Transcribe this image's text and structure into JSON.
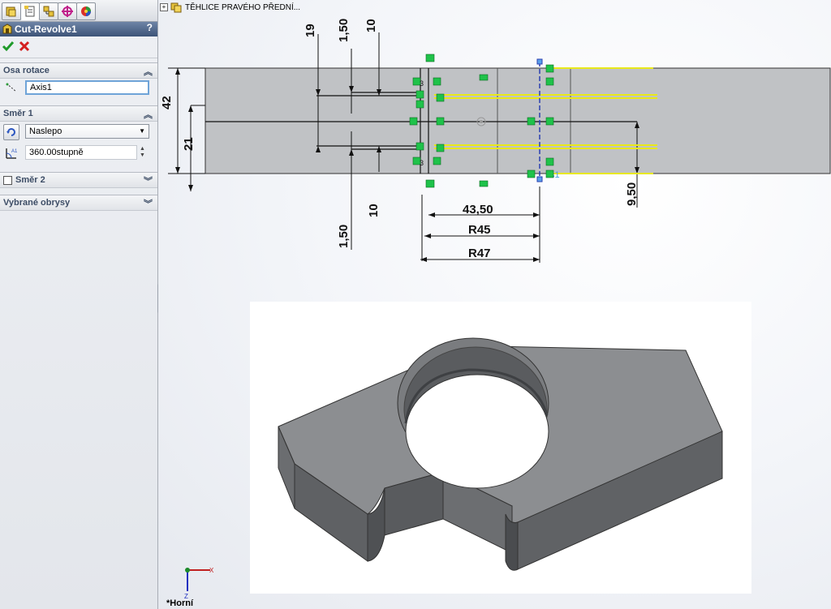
{
  "property_manager": {
    "tab_icons": [
      "feature-manager-icon",
      "property-manager-icon",
      "configuration-manager-icon",
      "dimxpert-icon",
      "appearance-icon"
    ],
    "feature_title": "Cut-Revolve1",
    "help_label": "?",
    "ok_icon": "checkmark-icon",
    "cancel_icon": "x-icon",
    "axis_section": {
      "label": "Osa rotace",
      "axis_value": "Axis1"
    },
    "direction1_section": {
      "label": "Směr 1",
      "type_value": "Naslepo",
      "angle_value": "360.00stupně"
    },
    "direction2_section": {
      "label": "Směr 2",
      "checked": false
    },
    "contours_section": {
      "label": "Vybrané obrysy"
    }
  },
  "viewport": {
    "tree_item": "TĚHLICE PRAVÉHO PŘEDNÍ...",
    "view_label": "*Horní",
    "triad_x": "X",
    "triad_z": "Z",
    "dimensions": {
      "d19": "19",
      "d150_top": "1,50",
      "d10_top": "10",
      "d42": "42",
      "d21": "21",
      "d10_bottom": "10",
      "d150_bottom": "1,50",
      "d4350": "43,50",
      "r45": "R45",
      "r47": "R47",
      "d950": "9,50"
    },
    "axis_label": "s1",
    "constraint_label_3": "3"
  },
  "colors": {
    "title_bar": "#4a6086",
    "relation_green": "#1fc24a",
    "sketch_yellow": "#e8e81a",
    "axis_blue": "#2a3fb0",
    "part_gray": "#8b8d90"
  }
}
